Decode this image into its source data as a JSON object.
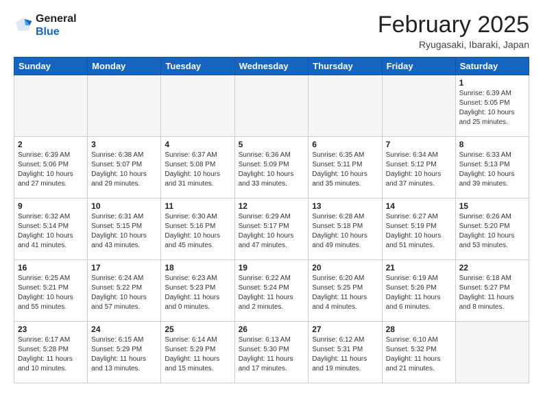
{
  "header": {
    "logo_general": "General",
    "logo_blue": "Blue",
    "month_title": "February 2025",
    "location": "Ryugasaki, Ibaraki, Japan"
  },
  "weekdays": [
    "Sunday",
    "Monday",
    "Tuesday",
    "Wednesday",
    "Thursday",
    "Friday",
    "Saturday"
  ],
  "weeks": [
    [
      {
        "day": "",
        "info": ""
      },
      {
        "day": "",
        "info": ""
      },
      {
        "day": "",
        "info": ""
      },
      {
        "day": "",
        "info": ""
      },
      {
        "day": "",
        "info": ""
      },
      {
        "day": "",
        "info": ""
      },
      {
        "day": "1",
        "info": "Sunrise: 6:39 AM\nSunset: 5:05 PM\nDaylight: 10 hours and 25 minutes."
      }
    ],
    [
      {
        "day": "2",
        "info": "Sunrise: 6:39 AM\nSunset: 5:06 PM\nDaylight: 10 hours and 27 minutes."
      },
      {
        "day": "3",
        "info": "Sunrise: 6:38 AM\nSunset: 5:07 PM\nDaylight: 10 hours and 29 minutes."
      },
      {
        "day": "4",
        "info": "Sunrise: 6:37 AM\nSunset: 5:08 PM\nDaylight: 10 hours and 31 minutes."
      },
      {
        "day": "5",
        "info": "Sunrise: 6:36 AM\nSunset: 5:09 PM\nDaylight: 10 hours and 33 minutes."
      },
      {
        "day": "6",
        "info": "Sunrise: 6:35 AM\nSunset: 5:11 PM\nDaylight: 10 hours and 35 minutes."
      },
      {
        "day": "7",
        "info": "Sunrise: 6:34 AM\nSunset: 5:12 PM\nDaylight: 10 hours and 37 minutes."
      },
      {
        "day": "8",
        "info": "Sunrise: 6:33 AM\nSunset: 5:13 PM\nDaylight: 10 hours and 39 minutes."
      }
    ],
    [
      {
        "day": "9",
        "info": "Sunrise: 6:32 AM\nSunset: 5:14 PM\nDaylight: 10 hours and 41 minutes."
      },
      {
        "day": "10",
        "info": "Sunrise: 6:31 AM\nSunset: 5:15 PM\nDaylight: 10 hours and 43 minutes."
      },
      {
        "day": "11",
        "info": "Sunrise: 6:30 AM\nSunset: 5:16 PM\nDaylight: 10 hours and 45 minutes."
      },
      {
        "day": "12",
        "info": "Sunrise: 6:29 AM\nSunset: 5:17 PM\nDaylight: 10 hours and 47 minutes."
      },
      {
        "day": "13",
        "info": "Sunrise: 6:28 AM\nSunset: 5:18 PM\nDaylight: 10 hours and 49 minutes."
      },
      {
        "day": "14",
        "info": "Sunrise: 6:27 AM\nSunset: 5:19 PM\nDaylight: 10 hours and 51 minutes."
      },
      {
        "day": "15",
        "info": "Sunrise: 6:26 AM\nSunset: 5:20 PM\nDaylight: 10 hours and 53 minutes."
      }
    ],
    [
      {
        "day": "16",
        "info": "Sunrise: 6:25 AM\nSunset: 5:21 PM\nDaylight: 10 hours and 55 minutes."
      },
      {
        "day": "17",
        "info": "Sunrise: 6:24 AM\nSunset: 5:22 PM\nDaylight: 10 hours and 57 minutes."
      },
      {
        "day": "18",
        "info": "Sunrise: 6:23 AM\nSunset: 5:23 PM\nDaylight: 11 hours and 0 minutes."
      },
      {
        "day": "19",
        "info": "Sunrise: 6:22 AM\nSunset: 5:24 PM\nDaylight: 11 hours and 2 minutes."
      },
      {
        "day": "20",
        "info": "Sunrise: 6:20 AM\nSunset: 5:25 PM\nDaylight: 11 hours and 4 minutes."
      },
      {
        "day": "21",
        "info": "Sunrise: 6:19 AM\nSunset: 5:26 PM\nDaylight: 11 hours and 6 minutes."
      },
      {
        "day": "22",
        "info": "Sunrise: 6:18 AM\nSunset: 5:27 PM\nDaylight: 11 hours and 8 minutes."
      }
    ],
    [
      {
        "day": "23",
        "info": "Sunrise: 6:17 AM\nSunset: 5:28 PM\nDaylight: 11 hours and 10 minutes."
      },
      {
        "day": "24",
        "info": "Sunrise: 6:15 AM\nSunset: 5:29 PM\nDaylight: 11 hours and 13 minutes."
      },
      {
        "day": "25",
        "info": "Sunrise: 6:14 AM\nSunset: 5:29 PM\nDaylight: 11 hours and 15 minutes."
      },
      {
        "day": "26",
        "info": "Sunrise: 6:13 AM\nSunset: 5:30 PM\nDaylight: 11 hours and 17 minutes."
      },
      {
        "day": "27",
        "info": "Sunrise: 6:12 AM\nSunset: 5:31 PM\nDaylight: 11 hours and 19 minutes."
      },
      {
        "day": "28",
        "info": "Sunrise: 6:10 AM\nSunset: 5:32 PM\nDaylight: 11 hours and 21 minutes."
      },
      {
        "day": "",
        "info": ""
      }
    ]
  ]
}
